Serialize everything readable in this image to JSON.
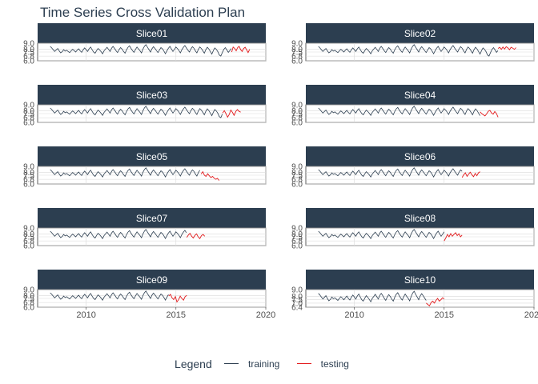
{
  "title": "Time Series Cross Validation Plan",
  "colors": {
    "strip_bg": "#2c3e50",
    "strip_text": "#ffffff",
    "training": "#2c3e50",
    "testing": "#e31a1c",
    "grid": "#d9d9d9",
    "axis_text": "#4d4d4d"
  },
  "legend": {
    "title": "Legend",
    "items": [
      {
        "label": "training",
        "color": "#2c3e50"
      },
      {
        "label": "testing",
        "color": "#e31a1c"
      }
    ]
  },
  "chart_data": {
    "type": "line",
    "facets": 10,
    "facet_layout": {
      "rows": 5,
      "cols": 2
    },
    "xlim": [
      2007.3,
      2020
    ],
    "x_ticks": [
      2010,
      2015,
      2020
    ],
    "x_tick_labels": [
      "2010",
      "2015",
      "2020"
    ],
    "series_start": 2008.0,
    "series_step_years": 0.0833,
    "base_series": [
      8.45,
      8.2,
      7.9,
      7.6,
      7.85,
      8.1,
      7.7,
      7.35,
      7.55,
      7.9,
      7.65,
      7.8,
      7.6,
      7.4,
      7.7,
      7.95,
      7.75,
      7.5,
      7.8,
      8.05,
      7.7,
      7.45,
      7.85,
      8.2,
      7.9,
      7.6,
      8.05,
      8.35,
      7.9,
      7.5,
      7.3,
      7.75,
      8.1,
      7.85,
      7.55,
      7.2,
      7.7,
      8.0,
      8.3,
      7.95,
      7.6,
      8.15,
      8.45,
      8.1,
      7.7,
      7.4,
      7.9,
      8.25,
      8.0,
      7.6,
      7.3,
      7.85,
      8.3,
      8.55,
      8.1,
      7.75,
      7.45,
      7.95,
      8.35,
      8.0,
      7.7,
      7.35,
      8.0,
      8.5,
      8.75,
      8.3,
      7.9,
      7.5,
      8.05,
      8.4,
      8.1,
      7.75,
      7.4,
      7.85,
      8.25,
      8.05,
      7.65,
      7.2,
      7.7,
      8.15,
      8.45,
      8.0,
      7.6,
      7.95,
      8.35,
      8.1,
      7.75,
      7.35,
      7.9,
      8.3,
      8.6,
      8.2,
      7.8,
      7.5,
      8.0,
      8.4,
      8.15,
      7.7,
      7.35,
      7.95,
      8.35,
      8.1,
      7.7,
      7.3,
      7.9,
      8.3,
      8.0,
      7.6,
      7.15,
      7.75,
      8.2,
      7.95,
      7.55,
      7.0,
      6.8,
      7.4,
      7.95,
      8.25,
      7.85,
      7.45,
      7.75,
      8.1,
      7.8,
      7.4,
      7.05,
      7.6,
      8.1,
      7.8,
      7.35,
      7.7,
      8.2,
      7.9,
      7.5,
      7.1,
      7.6,
      8.0,
      7.75,
      7.3,
      6.95,
      7.5,
      8.05,
      7.75,
      7.3,
      7.0,
      7.55,
      7.9
    ],
    "slices": [
      {
        "label": "Slice01",
        "ylim": [
          6.0,
          9.0
        ],
        "y_ticks": [
          6.0,
          6.8,
          7.5,
          8.0,
          9.0
        ],
        "y_tick_labels": [
          "6.0",
          "6.8",
          "7.5",
          "8.0",
          "9.0"
        ],
        "train_end": 2018.1,
        "test_end": 2019.1,
        "test_values": [
          7.5,
          8.35,
          8.1,
          7.7,
          8.25,
          8.45,
          7.9,
          7.6,
          8.1,
          8.3,
          7.85,
          7.4,
          7.95
        ]
      },
      {
        "label": "Slice02",
        "ylim": [
          6.0,
          9.0
        ],
        "y_ticks": [
          6.0,
          6.8,
          7.5,
          8.0,
          9.0
        ],
        "y_tick_labels": [
          "6.0",
          "6.8",
          "7.5",
          "8.0",
          "9.0"
        ],
        "train_end": 2018.0,
        "test_end": 2019.0,
        "test_values": [
          8.1,
          8.3,
          7.95,
          8.35,
          8.0,
          8.4,
          8.2,
          7.9,
          8.3,
          8.15,
          7.95,
          8.25
        ]
      },
      {
        "label": "Slice03",
        "ylim": [
          6.0,
          9.0
        ],
        "y_ticks": [
          6.0,
          6.8,
          7.5,
          8.0,
          9.0
        ],
        "y_tick_labels": [
          "6.0",
          "6.8",
          "7.5",
          "8.0",
          "9.0"
        ],
        "train_end": 2017.6,
        "test_end": 2018.6,
        "test_values": [
          7.6,
          8.0,
          7.5,
          6.9,
          7.35,
          8.1,
          7.7,
          7.2,
          7.85,
          8.2,
          7.9,
          7.75
        ]
      },
      {
        "label": "Slice04",
        "ylim": [
          6.0,
          9.0
        ],
        "y_ticks": [
          6.0,
          6.8,
          7.5,
          8.0,
          9.0
        ],
        "y_tick_labels": [
          "6.0",
          "6.8",
          "7.5",
          "8.0",
          "9.0"
        ],
        "train_end": 2017.0,
        "test_end": 2018.0,
        "test_values": [
          7.8,
          7.5,
          7.3,
          7.1,
          7.45,
          7.9,
          8.05,
          7.6,
          7.4,
          7.85,
          7.5,
          6.9
        ]
      },
      {
        "label": "Slice05",
        "ylim": [
          6.0,
          9.0
        ],
        "y_ticks": [
          6.0,
          6.8,
          7.5,
          8.0,
          9.0
        ],
        "y_tick_labels": [
          "6.0",
          "6.8",
          "7.5",
          "8.0",
          "9.0"
        ],
        "train_end": 2016.4,
        "test_end": 2017.4,
        "test_values": [
          7.7,
          8.1,
          7.5,
          7.3,
          7.75,
          7.4,
          7.1,
          7.3,
          7.0,
          6.8,
          6.95,
          6.6
        ]
      },
      {
        "label": "Slice06",
        "ylim": [
          6.0,
          9.0
        ],
        "y_ticks": [
          6.0,
          6.8,
          7.5,
          8.0,
          9.0
        ],
        "y_tick_labels": [
          "6.0",
          "6.8",
          "7.5",
          "8.0",
          "9.0"
        ],
        "train_end": 2016.0,
        "test_end": 2017.0,
        "test_values": [
          7.1,
          7.6,
          7.9,
          7.3,
          7.7,
          8.0,
          7.55,
          7.25,
          7.8,
          7.4,
          7.9,
          8.1
        ]
      },
      {
        "label": "Slice07",
        "ylim": [
          6.0,
          9.0
        ],
        "y_ticks": [
          6.0,
          6.8,
          7.5,
          8.0,
          9.0
        ],
        "y_tick_labels": [
          "6.0",
          "6.8",
          "7.5",
          "8.0",
          "9.0"
        ],
        "train_end": 2015.6,
        "test_end": 2016.6,
        "test_values": [
          7.4,
          7.8,
          8.1,
          7.6,
          7.3,
          7.75,
          8.0,
          7.5,
          7.2,
          7.7,
          7.9,
          7.6
        ]
      },
      {
        "label": "Slice08",
        "ylim": [
          6.0,
          9.0
        ],
        "y_ticks": [
          6.0,
          6.8,
          7.5,
          8.0,
          9.0
        ],
        "y_tick_labels": [
          "6.0",
          "6.8",
          "7.5",
          "8.0",
          "9.0"
        ],
        "train_end": 2015.0,
        "test_end": 2016.0,
        "test_values": [
          6.8,
          7.3,
          7.9,
          7.5,
          8.05,
          7.6,
          7.9,
          8.2,
          7.7,
          8.0,
          7.5,
          7.8
        ]
      },
      {
        "label": "Slice09",
        "ylim": [
          6.0,
          9.0
        ],
        "y_ticks": [
          6.0,
          6.8,
          7.5,
          8.0,
          9.0
        ],
        "y_tick_labels": [
          "6.0",
          "6.8",
          "7.5",
          "8.0",
          "9.0"
        ],
        "train_end": 2014.6,
        "test_end": 2015.6,
        "test_values": [
          7.9,
          8.2,
          7.6,
          7.3,
          7.8,
          6.9,
          7.3,
          7.9,
          7.5,
          7.2,
          7.8,
          8.0
        ]
      },
      {
        "label": "Slice10",
        "ylim": [
          6.4,
          9.0
        ],
        "y_ticks": [
          6.4,
          7.0,
          7.5,
          8.0,
          9.0
        ],
        "y_tick_labels": [
          "6.4",
          "7.0",
          "7.5",
          "8.0",
          "9.0"
        ],
        "train_end": 2014.0,
        "test_end": 2015.0,
        "test_values": [
          7.0,
          6.8,
          6.6,
          7.1,
          7.3,
          7.0,
          7.4,
          7.7,
          7.3,
          7.5,
          7.8,
          7.6
        ]
      }
    ]
  }
}
